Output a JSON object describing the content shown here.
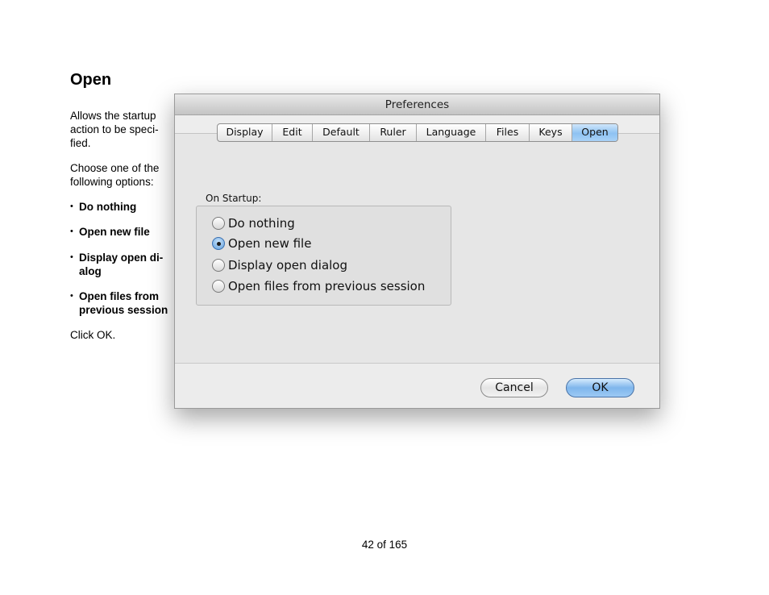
{
  "doc": {
    "title": "Open",
    "intro": "Allows the startup action to be speci-fied.",
    "choose": "Choose one of the following options:",
    "bullets": [
      "Do nothing",
      "Open new file",
      "Display open di-alog",
      "Open files from previous session"
    ],
    "click_ok": "Click OK.",
    "page_number": "42 of 165"
  },
  "dialog": {
    "title": "Preferences",
    "tabs": [
      "Display",
      "Edit",
      "Default",
      "Ruler",
      "Language",
      "Files",
      "Keys",
      "Open"
    ],
    "selected_tab": "Open",
    "group_label": "On Startup:",
    "options": [
      "Do nothing",
      "Open new file",
      "Display open dialog",
      "Open files from previous session"
    ],
    "selected_option": "Open new file",
    "cancel_label": "Cancel",
    "ok_label": "OK"
  }
}
